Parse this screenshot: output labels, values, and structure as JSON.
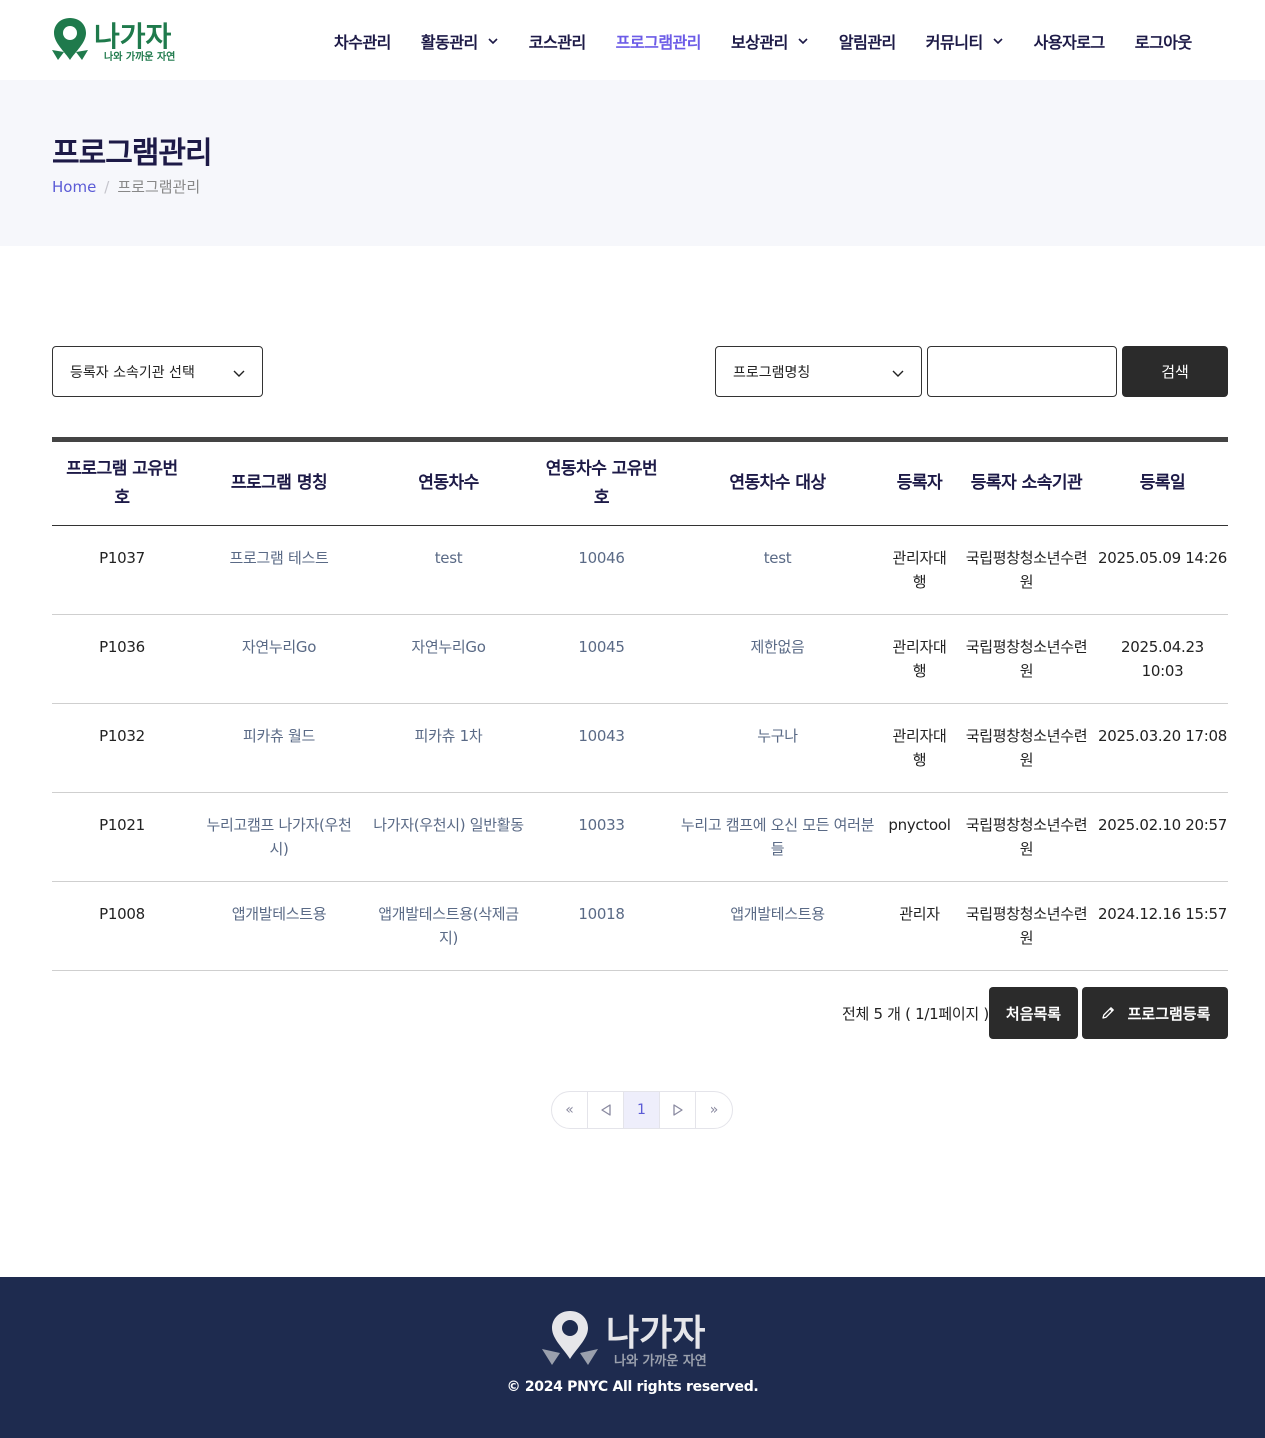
{
  "brand": {
    "logo_text": "나가자",
    "logo_tagline": "나와 가까운 자연",
    "primary_color": "#1f7a4c",
    "accent_color": "#6c5ce7",
    "footer_bg": "#1e2b4f"
  },
  "nav": {
    "items": [
      {
        "label": "차수관리",
        "has_dropdown": false,
        "active": false
      },
      {
        "label": "활동관리",
        "has_dropdown": true,
        "active": false
      },
      {
        "label": "코스관리",
        "has_dropdown": false,
        "active": false
      },
      {
        "label": "프로그램관리",
        "has_dropdown": false,
        "active": true
      },
      {
        "label": "보상관리",
        "has_dropdown": true,
        "active": false
      },
      {
        "label": "알림관리",
        "has_dropdown": false,
        "active": false
      },
      {
        "label": "커뮤니티",
        "has_dropdown": true,
        "active": false
      },
      {
        "label": "사용자로그",
        "has_dropdown": false,
        "active": false
      },
      {
        "label": "로그아웃",
        "has_dropdown": false,
        "active": false
      }
    ]
  },
  "page": {
    "title": "프로그램관리",
    "breadcrumb": {
      "home": "Home",
      "separator": "/",
      "current": "프로그램관리"
    }
  },
  "filters": {
    "org_select": "등록자 소속기관 선택",
    "field_select": "프로그램명칭",
    "search_value": "",
    "search_placeholder": "",
    "search_button": "검색"
  },
  "table": {
    "headers": [
      {
        "line1": "프로그램 고유번",
        "line2": "호"
      },
      {
        "line1": "프로그램 명칭",
        "line2": ""
      },
      {
        "line1": "연동차수",
        "line2": ""
      },
      {
        "line1": "연동차수 고유번",
        "line2": "호"
      },
      {
        "line1": "연동차수 대상",
        "line2": ""
      },
      {
        "line1": "등록자",
        "line2": ""
      },
      {
        "line1": "등록자 소속기관",
        "line2": ""
      },
      {
        "line1": "등록일",
        "line2": ""
      }
    ],
    "rows": [
      {
        "id": "P1037",
        "name": "프로그램 테스트",
        "name2": "",
        "round": "test",
        "round2": "",
        "round_id": "10046",
        "target": "test",
        "target2": "",
        "registrant": "관리자대",
        "registrant2": "행",
        "org": "국립평창청소년수련",
        "org2": "원",
        "date": "2025.05.09 14:26",
        "date2": ""
      },
      {
        "id": "P1036",
        "name": "자연누리Go",
        "name2": "",
        "round": "자연누리Go",
        "round2": "",
        "round_id": "10045",
        "target": "제한없음",
        "target2": "",
        "registrant": "관리자대",
        "registrant2": "행",
        "org": "국립평창청소년수련",
        "org2": "원",
        "date": "2025.04.23",
        "date2": "10:03"
      },
      {
        "id": "P1032",
        "name": "피카츄 월드",
        "name2": "",
        "round": "피카츄 1차",
        "round2": "",
        "round_id": "10043",
        "target": "누구나",
        "target2": "",
        "registrant": "관리자대",
        "registrant2": "행",
        "org": "국립평창청소년수련",
        "org2": "원",
        "date": "2025.03.20 17:08",
        "date2": ""
      },
      {
        "id": "P1021",
        "name": "누리고캠프 나가자(우천",
        "name2": "시)",
        "round": "나가자(우천시) 일반활동",
        "round2": "",
        "round_id": "10033",
        "target": "누리고 캠프에 오신 모든 여러분",
        "target2": "들",
        "registrant": "pnyctool",
        "registrant2": "",
        "org": "국립평창청소년수련",
        "org2": "원",
        "date": "2025.02.10 20:57",
        "date2": ""
      },
      {
        "id": "P1008",
        "name": "앱개발테스트용",
        "name2": "",
        "round": "앱개발테스트용(삭제금",
        "round2": "지)",
        "round_id": "10018",
        "target": "앱개발테스트용",
        "target2": "",
        "registrant": "관리자",
        "registrant2": "",
        "org": "국립평창청소년수련",
        "org2": "원",
        "date": "2024.12.16 15:57",
        "date2": ""
      }
    ]
  },
  "summary": {
    "text": "전체 5 개 ( 1/1페이지 )",
    "first_list_button": "처음목록",
    "register_button": "프로그램등록"
  },
  "pagination": {
    "first": "«",
    "prev_icon": "triangle-left-icon",
    "current": "1",
    "next_icon": "triangle-right-icon",
    "last": "»"
  },
  "footer": {
    "copyright": "© 2024 PNYC All rights reserved."
  }
}
